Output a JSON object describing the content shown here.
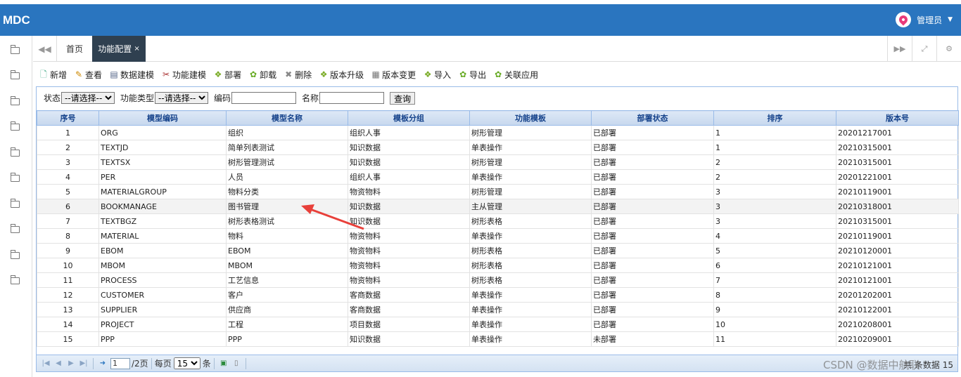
{
  "app": {
    "logo": "MDC",
    "user": "管理员"
  },
  "tabs": [
    {
      "label": "首页"
    },
    {
      "label": "功能配置",
      "close": "×"
    }
  ],
  "toolbar": [
    {
      "label": "新增",
      "icon": "new-doc-icon"
    },
    {
      "label": "查看",
      "icon": "edit-icon"
    },
    {
      "label": "数据建模",
      "icon": "data-model-icon"
    },
    {
      "label": "功能建模",
      "icon": "tools-icon"
    },
    {
      "label": "部署",
      "icon": "deploy-icon"
    },
    {
      "label": "卸载",
      "icon": "uninstall-icon"
    },
    {
      "label": "删除",
      "icon": "delete-icon"
    },
    {
      "label": "版本升级",
      "icon": "upgrade-icon"
    },
    {
      "label": "版本变更",
      "icon": "change-icon"
    },
    {
      "label": "导入",
      "icon": "import-icon"
    },
    {
      "label": "导出",
      "icon": "export-icon"
    },
    {
      "label": "关联应用",
      "icon": "link-app-icon"
    }
  ],
  "search": {
    "status_label": "状态",
    "status_value": "--请选择--",
    "type_label": "功能类型",
    "type_value": "--请选择--",
    "code_label": "编码",
    "name_label": "名称",
    "query_label": "查询"
  },
  "columns": [
    "序号",
    "模型编码",
    "模型名称",
    "模板分组",
    "功能模板",
    "部署状态",
    "排序",
    "版本号"
  ],
  "rows": [
    [
      "1",
      "ORG",
      "组织",
      "组织人事",
      "树形管理",
      "已部署",
      "1",
      "20201217001"
    ],
    [
      "2",
      "TEXTJD",
      "简单列表测试",
      "知识数据",
      "单表操作",
      "已部署",
      "1",
      "20210315001"
    ],
    [
      "3",
      "TEXTSX",
      "树形管理测试",
      "知识数据",
      "树形管理",
      "已部署",
      "2",
      "20210315001"
    ],
    [
      "4",
      "PER",
      "人员",
      "组织人事",
      "单表操作",
      "已部署",
      "2",
      "20201221001"
    ],
    [
      "5",
      "MATERIALGROUP",
      "物料分类",
      "物资物料",
      "树形管理",
      "已部署",
      "3",
      "20210119001"
    ],
    [
      "6",
      "BOOKMANAGE",
      "图书管理",
      "知识数据",
      "主从管理",
      "已部署",
      "3",
      "20210318001"
    ],
    [
      "7",
      "TEXTBGZ",
      "树形表格测试",
      "知识数据",
      "树形表格",
      "已部署",
      "3",
      "20210315001"
    ],
    [
      "8",
      "MATERIAL",
      "物料",
      "物资物料",
      "单表操作",
      "已部署",
      "4",
      "20210119001"
    ],
    [
      "9",
      "EBOM",
      "EBOM",
      "物资物料",
      "树形表格",
      "已部署",
      "5",
      "20210120001"
    ],
    [
      "10",
      "MBOM",
      "MBOM",
      "物资物料",
      "树形表格",
      "已部署",
      "6",
      "20210121001"
    ],
    [
      "11",
      "PROCESS",
      "工艺信息",
      "物资物料",
      "树形表格",
      "已部署",
      "7",
      "20210121001"
    ],
    [
      "12",
      "CUSTOMER",
      "客户",
      "客商数据",
      "单表操作",
      "已部署",
      "8",
      "20201202001"
    ],
    [
      "13",
      "SUPPLIER",
      "供应商",
      "客商数据",
      "单表操作",
      "已部署",
      "9",
      "20210122001"
    ],
    [
      "14",
      "PROJECT",
      "工程",
      "项目数据",
      "单表操作",
      "已部署",
      "10",
      "20210208001"
    ],
    [
      "15",
      "PPP",
      "PPP",
      "知识数据",
      "单表操作",
      "未部署",
      "11",
      "20210209001"
    ]
  ],
  "pager": {
    "page": "1",
    "pages_label": "/2页",
    "per_page_label": "每页",
    "per_page": "15",
    "unit": "条",
    "total": "共 条数据 15"
  },
  "watermark": "CSDN @数据中航联",
  "colors": {
    "header": "#2a75bf",
    "active_tab": "#2f4050",
    "arrow": "#e8403a"
  }
}
